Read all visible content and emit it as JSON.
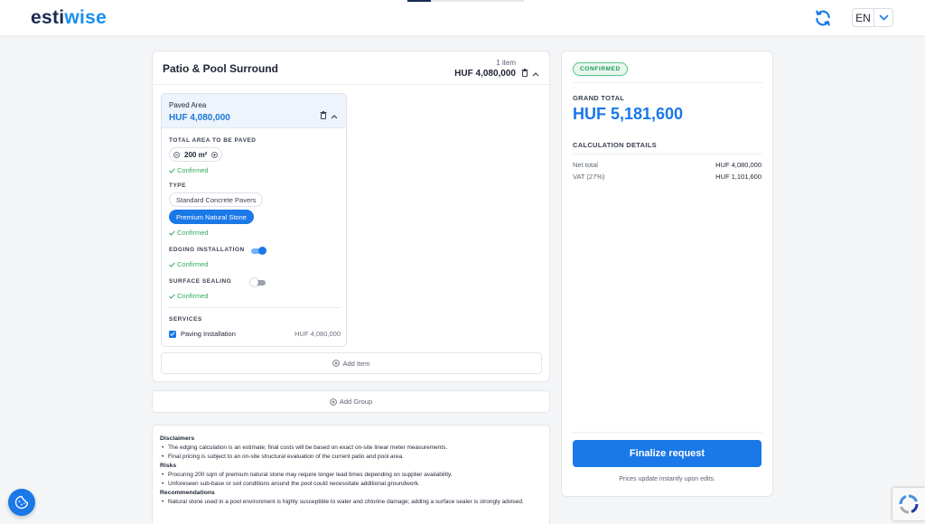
{
  "brand": {
    "logo_prefix": "esti",
    "logo_suffix": "wise"
  },
  "header": {
    "language": "EN"
  },
  "group": {
    "title": "Patio & Pool Surround",
    "item_count": "1 item",
    "price": "HUF 4,080,000",
    "add_item_label": "Add Item"
  },
  "item": {
    "name": "Paved Area",
    "price": "HUF 4,080,000",
    "area_label": "TOTAL AREA TO BE PAVED",
    "area_value": "200 m²",
    "type_label": "TYPE",
    "type_options": [
      "Standard Concrete Pavers",
      "Premium Natural Stone"
    ],
    "type_selected": "Premium Natural Stone",
    "edging_label": "EDGING INSTALLATION",
    "edging_on": true,
    "sealing_label": "SURFACE SEALING",
    "sealing_on": false,
    "confirmed_label": "Confirmed",
    "services_label": "SERVICES",
    "service_name": "Paving Installation",
    "service_price": "HUF 4,080,000",
    "service_checked": true
  },
  "add_group_label": "Add Group",
  "notes": {
    "disclaimers_title": "Disclaimers",
    "disclaimers": [
      "The edging calculation is an estimate; final costs will be based on exact on-site linear meter measurements.",
      "Final pricing is subject to an on-site structural evaluation of the current patio and pool area."
    ],
    "risks_title": "Risks",
    "risks": [
      "Procuring 200 sqm of premium natural stone may require longer lead times depending on supplier availability.",
      "Unforeseen sub-base or soil conditions around the pool could necessitate additional groundwork."
    ],
    "recommendations_title": "Recommendations",
    "recommendations": [
      "Natural stone used in a pool environment is highly susceptible to water and chlorine damage; adding a surface sealer is strongly advised."
    ]
  },
  "summary": {
    "status_badge": "CONFIRMED",
    "grand_total_label": "GRAND TOTAL",
    "grand_total_value": "HUF 5,181,600",
    "calc_label": "CALCULATION DETAILS",
    "net_label": "Net total",
    "net_value": "HUF 4,080,000",
    "vat_label": "VAT (27%)",
    "vat_value": "HUF 1,101,600",
    "finalize_label": "Finalize request",
    "price_note": "Prices update instantly upon edits."
  },
  "colors": {
    "accent": "#1a78e8",
    "brand_dark": "#1b2a52",
    "success": "#2faa5e"
  }
}
